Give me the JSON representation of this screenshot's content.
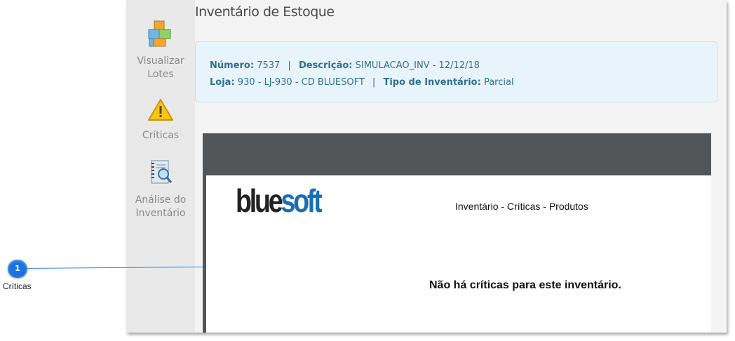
{
  "sidebar": {
    "items": [
      {
        "label_line1": "Visualizar",
        "label_line2": "Lotes",
        "icon": "boxes-icon"
      },
      {
        "label": "Críticas",
        "icon": "warning-icon"
      },
      {
        "label_line1": "Análise do",
        "label_line2": "Inventário",
        "icon": "notebook-search-icon"
      }
    ]
  },
  "page": {
    "title": "Inventário de Estoque"
  },
  "info": {
    "numero_label": "Número:",
    "numero_value": "7537",
    "separator": "|",
    "descricao_label": "Descrição:",
    "descricao_value": "SIMULACAO_INV - 12/12/18",
    "loja_label": "Loja:",
    "loja_value": "930 - LJ-930 - CD BLUESOFT",
    "tipo_label": "Tipo de Inventário:",
    "tipo_value": "Parcial"
  },
  "report": {
    "logo_part1": "blue",
    "logo_part2": "soft",
    "header": "Inventário - Críticas - Produtos",
    "message": "Não há críticas para este inventário."
  },
  "callout": {
    "number": "1",
    "label": "Críticas"
  },
  "colors": {
    "accent": "#1c73e0",
    "info_text": "#31708f",
    "info_bg": "#e8f4fb",
    "logo_blue": "#1a6fb4"
  }
}
